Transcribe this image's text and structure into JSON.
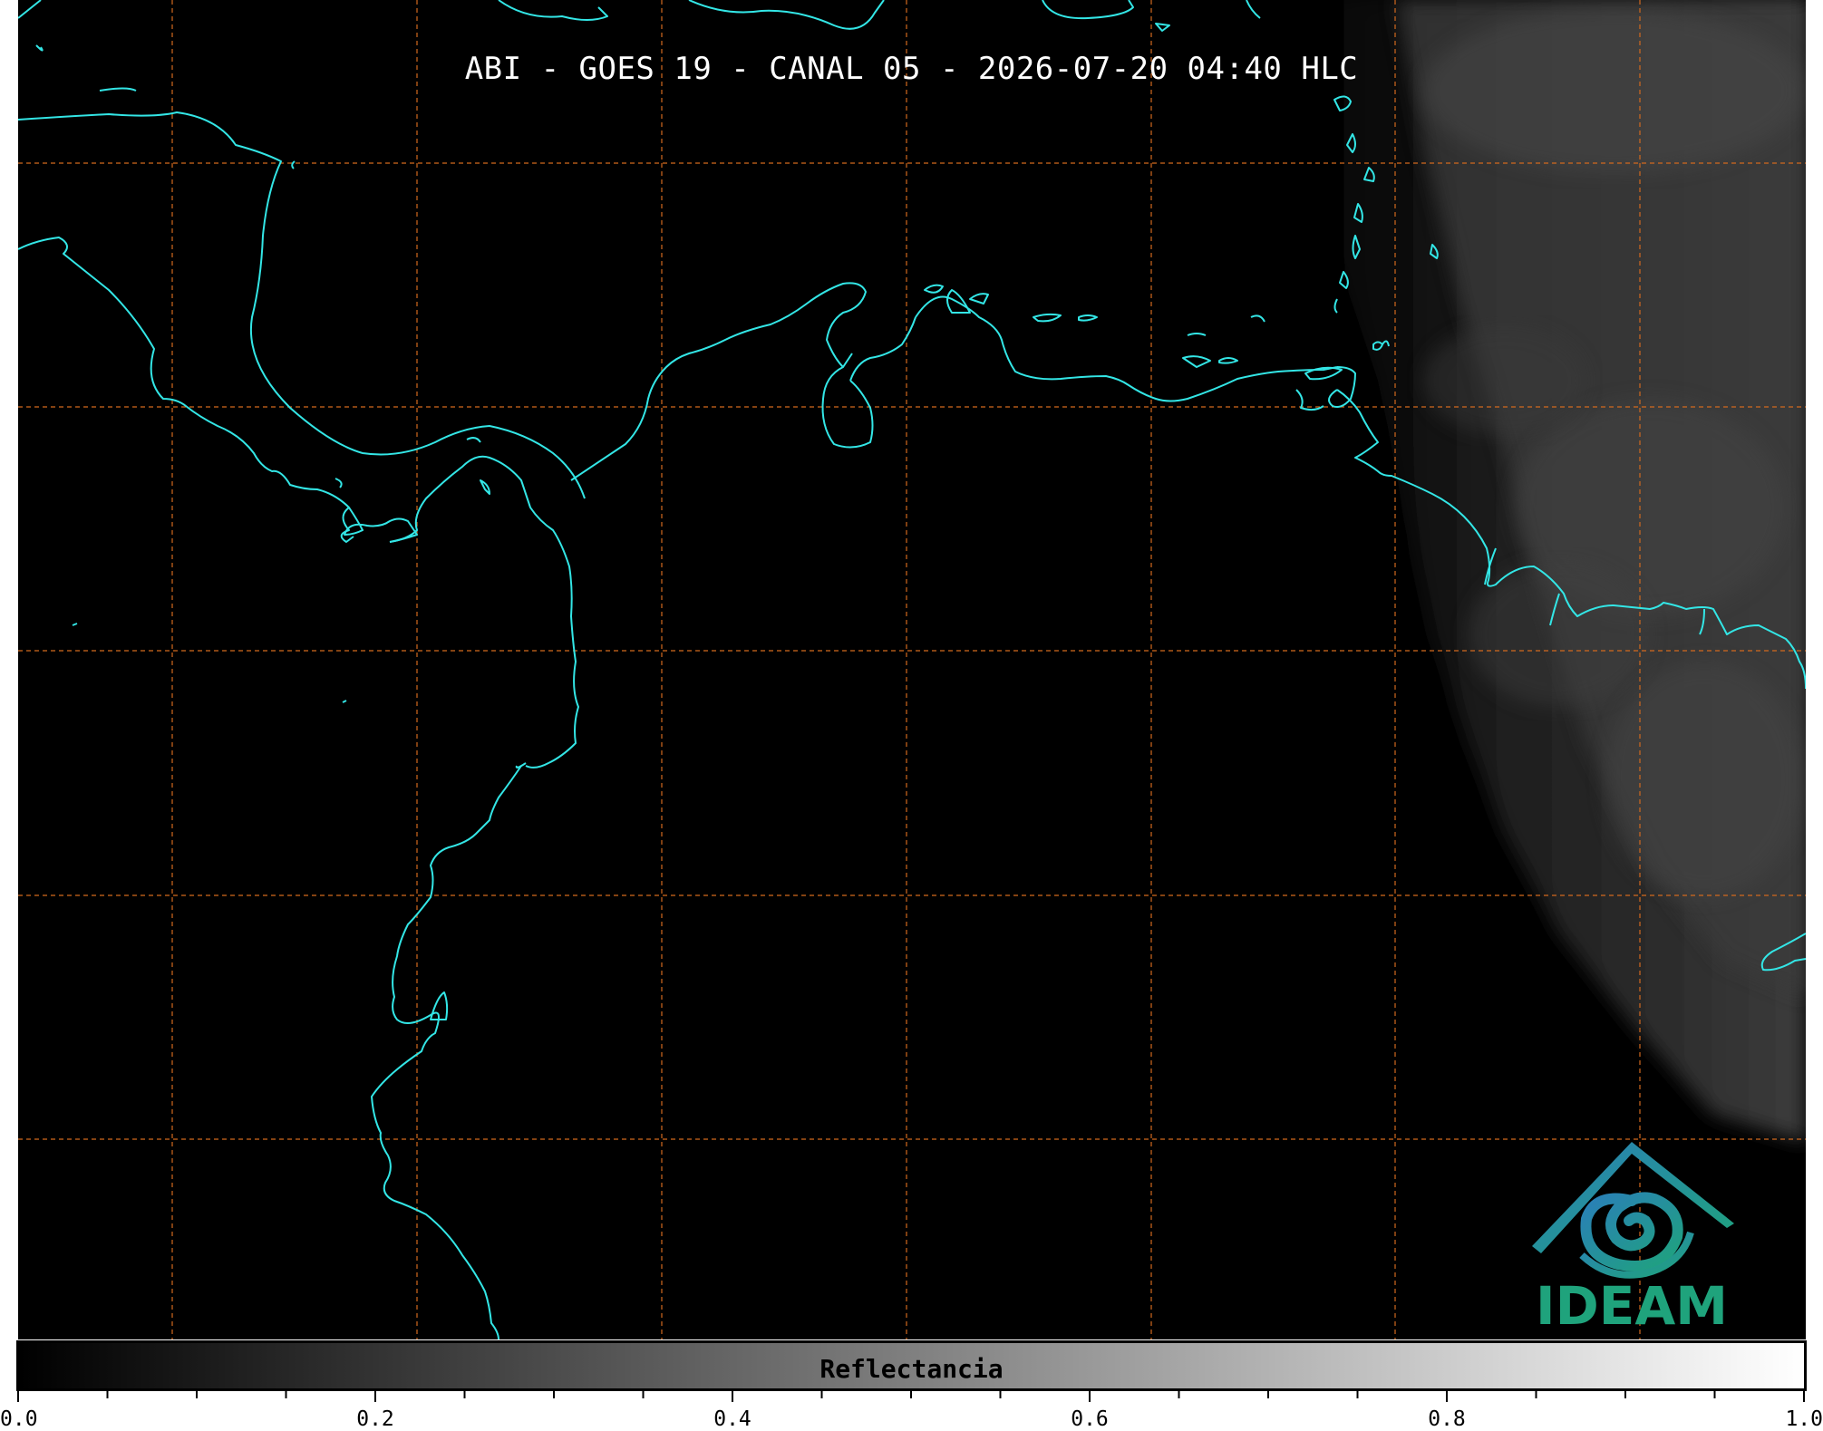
{
  "title": "ABI - GOES 19 - CANAL 05 - 2026-07-20 04:40 HLC",
  "map": {
    "background": "#000000",
    "coastline_color": "#33e6e6",
    "gridline_color": "#d2691e",
    "gridlines": "dashed",
    "features": [
      "coastline",
      "lat-lon-grid",
      "cloud-field"
    ]
  },
  "colorbar": {
    "label": "Reflectancia",
    "range": [
      0.0,
      1.0
    ],
    "colormap": "gray",
    "tick_labels": [
      "0.0",
      "0.2",
      "0.4",
      "0.6",
      "0.8",
      "1.0"
    ]
  },
  "logo": {
    "text": "IDEAM",
    "colors": [
      "#2a7fb8",
      "#1fa37c"
    ]
  }
}
